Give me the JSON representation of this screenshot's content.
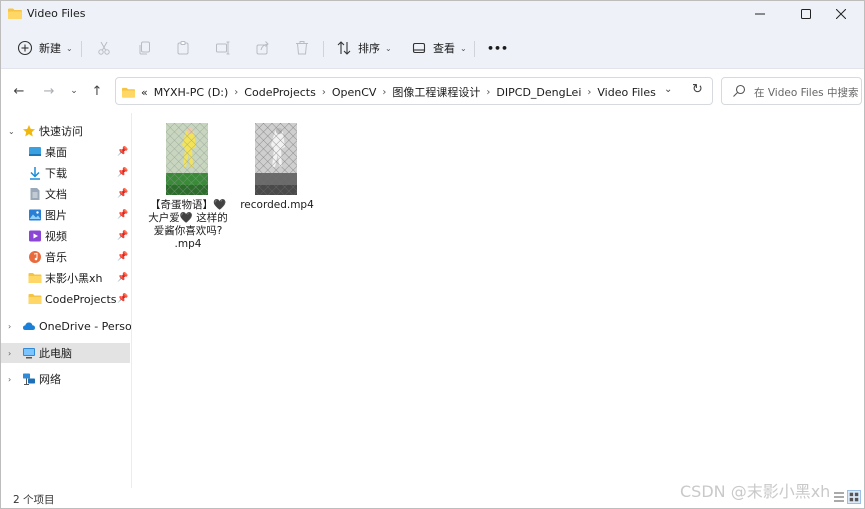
{
  "window": {
    "title": "Video Files"
  },
  "toolbar": {
    "new_label": "新建",
    "sort_label": "排序",
    "view_label": "查看",
    "more_label": "•••"
  },
  "address": {
    "overflow": "«",
    "crumbs": [
      "MYXH-PC (D:)",
      "CodeProjects",
      "OpenCV",
      "图像工程课程设计",
      "DIPCD_DengLei",
      "Video Files"
    ]
  },
  "search": {
    "placeholder": "在 Video Files 中搜索"
  },
  "sidebar": {
    "quick_access": "快速访问",
    "items": [
      {
        "label": "桌面"
      },
      {
        "label": "下载"
      },
      {
        "label": "文档"
      },
      {
        "label": "图片"
      },
      {
        "label": "视频"
      },
      {
        "label": "音乐"
      },
      {
        "label": "末影小黑xh"
      },
      {
        "label": "CodeProjects"
      }
    ],
    "onedrive": "OneDrive - Persona",
    "this_pc": "此电脑",
    "network": "网络"
  },
  "files": [
    {
      "line1": "【奇蛋物语】🖤",
      "line2": "大户爱🖤 这样的",
      "line3": "爱酱你喜欢吗?",
      "line4": ".mp4"
    },
    {
      "line1": "recorded.mp4"
    }
  ],
  "status": {
    "count": "2 个项目"
  },
  "watermark": "CSDN @末影小黑xh",
  "colors": {
    "accent": "#0067c0",
    "folder": "#f6c445"
  }
}
